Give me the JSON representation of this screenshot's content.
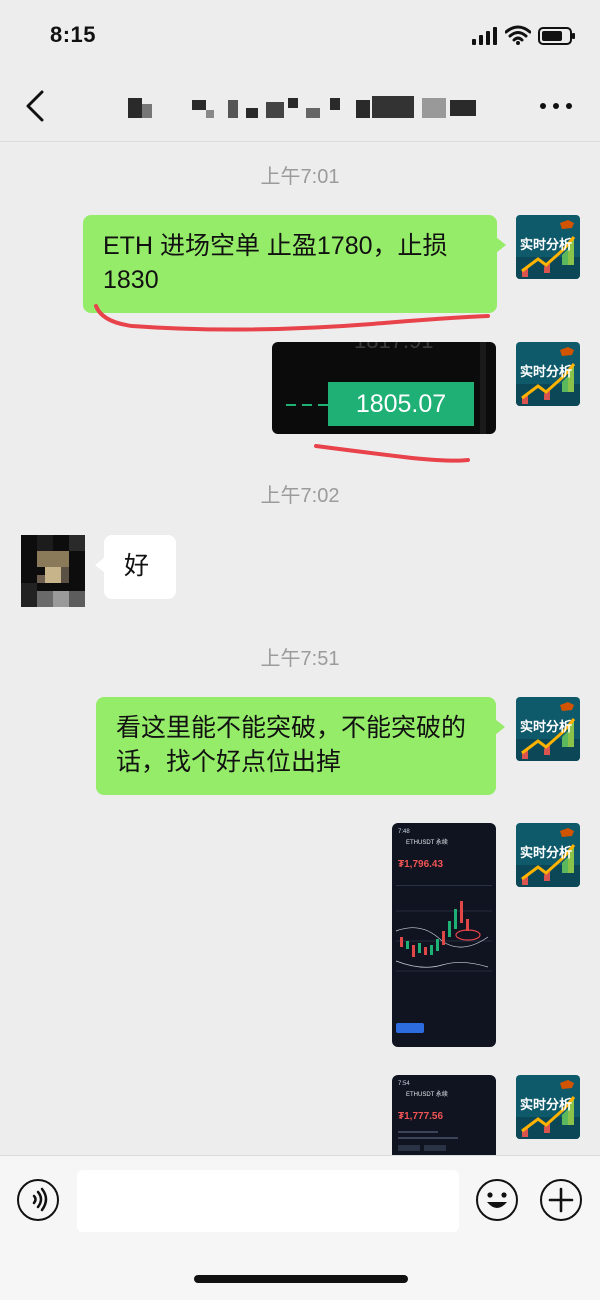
{
  "status_bar": {
    "time": "8:15"
  },
  "header": {
    "icons": {
      "back": "back-chevron-icon",
      "more": "more-dots-icon"
    }
  },
  "chat": {
    "timestamps": [
      "上午7:01",
      "上午7:02",
      "上午7:51"
    ],
    "messages": [
      {
        "from": "me",
        "text": "ETH 进场空单 止盈1780，止损1830"
      },
      {
        "from": "me",
        "type": "image",
        "price_label": "1805.07",
        "faded_label": "1817.91"
      },
      {
        "from": "other",
        "text": "好"
      },
      {
        "from": "me",
        "text": "看这里能不能突破，不能突破的话，找个好点位出掉"
      },
      {
        "from": "me",
        "type": "image",
        "screenshot": {
          "header": "7:48",
          "title": "ETHUSDT 永续",
          "price": "₮1,796.43"
        }
      },
      {
        "from": "me",
        "type": "image",
        "screenshot": {
          "header": "7:54",
          "title": "ETHUSDT 永续",
          "price": "₮1,777.56"
        }
      }
    ],
    "brand_avatar_text": "实时分析"
  },
  "colors": {
    "background": "#ededed",
    "my_bubble": "#95ec69",
    "other_bubble": "#ffffff",
    "timestamp_text": "#9b9b9b",
    "price_green": "#1fb075",
    "annotation_red": "#e8434a"
  }
}
